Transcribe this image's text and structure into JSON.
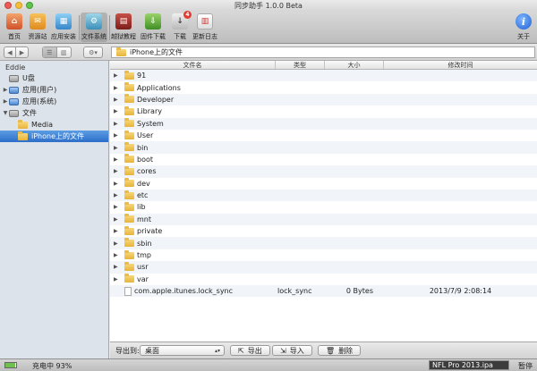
{
  "window": {
    "title": "同步助手 1.0.0 Beta"
  },
  "toolbar": {
    "items": [
      {
        "label": "首页",
        "icon": "home-icon"
      },
      {
        "label": "资源站",
        "icon": "store-icon"
      },
      {
        "label": "应用安装",
        "icon": "apps-icon"
      },
      {
        "label": "文件系统",
        "icon": "filesystem-icon"
      },
      {
        "label": "越狱教程",
        "icon": "book-icon"
      },
      {
        "label": "固件下载",
        "icon": "firmware-icon"
      },
      {
        "label": "下载",
        "icon": "download-icon"
      },
      {
        "label": "更新日志",
        "icon": "calendar-icon"
      }
    ],
    "about_label": "关于",
    "download_badge": "4"
  },
  "navbar": {
    "path": "iPhone上的文件"
  },
  "sidebar": {
    "device": "Eddie",
    "items": [
      {
        "label": "U盘"
      },
      {
        "label": "应用(用户)"
      },
      {
        "label": "应用(系统)"
      },
      {
        "label": "文件"
      },
      {
        "label": "Media"
      },
      {
        "label": "iPhone上的文件"
      }
    ]
  },
  "list": {
    "columns": [
      "文件名",
      "类型",
      "大小",
      "修改时间"
    ],
    "rows": [
      {
        "name": "91",
        "type": "",
        "size": "",
        "date": ""
      },
      {
        "name": "Applications",
        "type": "",
        "size": "",
        "date": ""
      },
      {
        "name": "Developer",
        "type": "",
        "size": "",
        "date": ""
      },
      {
        "name": "Library",
        "type": "",
        "size": "",
        "date": ""
      },
      {
        "name": "System",
        "type": "",
        "size": "",
        "date": ""
      },
      {
        "name": "User",
        "type": "",
        "size": "",
        "date": ""
      },
      {
        "name": "bin",
        "type": "",
        "size": "",
        "date": ""
      },
      {
        "name": "boot",
        "type": "",
        "size": "",
        "date": ""
      },
      {
        "name": "cores",
        "type": "",
        "size": "",
        "date": ""
      },
      {
        "name": "dev",
        "type": "",
        "size": "",
        "date": ""
      },
      {
        "name": "etc",
        "type": "",
        "size": "",
        "date": ""
      },
      {
        "name": "lib",
        "type": "",
        "size": "",
        "date": ""
      },
      {
        "name": "mnt",
        "type": "",
        "size": "",
        "date": ""
      },
      {
        "name": "private",
        "type": "",
        "size": "",
        "date": ""
      },
      {
        "name": "sbin",
        "type": "",
        "size": "",
        "date": ""
      },
      {
        "name": "tmp",
        "type": "",
        "size": "",
        "date": ""
      },
      {
        "name": "usr",
        "type": "",
        "size": "",
        "date": ""
      },
      {
        "name": "var",
        "type": "",
        "size": "",
        "date": ""
      },
      {
        "name": "com.apple.itunes.lock_sync",
        "type": "lock_sync",
        "size": "0 Bytes",
        "date": "2013/7/9 2:08:14"
      }
    ]
  },
  "bottom": {
    "export_to_label": "导出到:",
    "export_target": "桌面",
    "export_button": "导出",
    "import_button": "导入",
    "delete_button": "删除"
  },
  "status": {
    "battery_text": "充电中 93%",
    "battery_level": 0.93,
    "task_name": "NFL Pro 2013.ipa",
    "pause_label": "暂停"
  }
}
